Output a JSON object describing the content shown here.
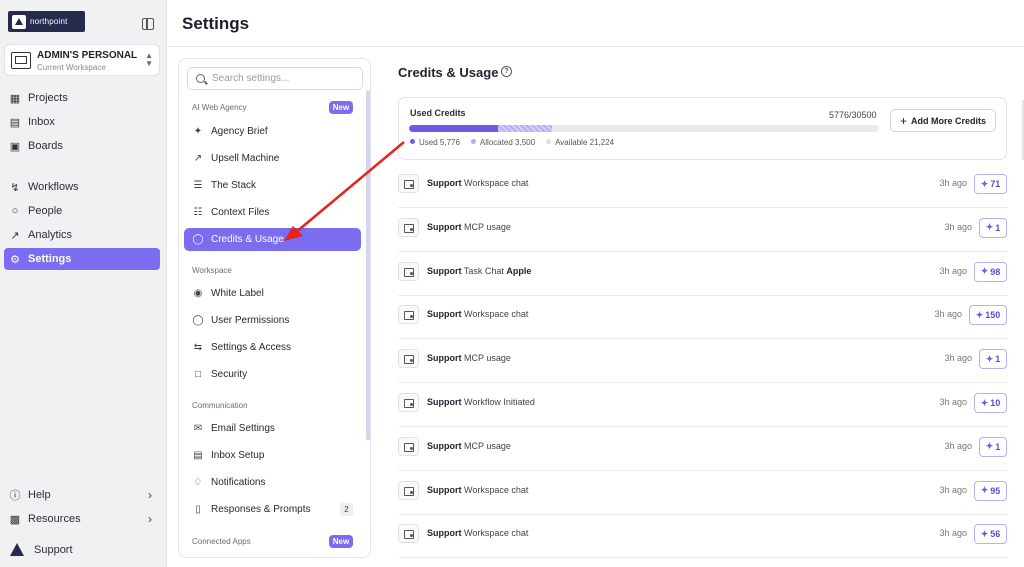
{
  "brand": {
    "name": "northpoint"
  },
  "workspace": {
    "name": "ADMIN'S PERSONAL ...",
    "subtitle": "Current Workspace"
  },
  "nav": {
    "items": [
      {
        "label": "Projects",
        "icon": "grid-icon"
      },
      {
        "label": "Inbox",
        "icon": "inbox-icon"
      },
      {
        "label": "Boards",
        "icon": "board-icon"
      },
      {
        "label": "Workflows",
        "icon": "workflow-icon"
      },
      {
        "label": "People",
        "icon": "person-icon"
      },
      {
        "label": "Analytics",
        "icon": "analytics-icon"
      },
      {
        "label": "Settings",
        "icon": "gear-icon"
      }
    ],
    "bottom": [
      {
        "label": "Help",
        "icon": "help-icon"
      },
      {
        "label": "Resources",
        "icon": "bar-chart-icon"
      }
    ],
    "support": "Support"
  },
  "page": {
    "title": "Settings"
  },
  "settings_panel": {
    "search_placeholder": "Search settings...",
    "sections": [
      {
        "label": "AI Web Agency",
        "badge": "New"
      },
      {
        "label": "Workspace"
      },
      {
        "label": "Communication"
      },
      {
        "label": "Connected Apps",
        "badge": "New"
      }
    ],
    "items": [
      {
        "label": "Agency Brief",
        "icon": "sparkle-icon"
      },
      {
        "label": "Upsell Machine",
        "icon": "trend-up-icon"
      },
      {
        "label": "The Stack",
        "icon": "layers-icon"
      },
      {
        "label": "Context Files",
        "icon": "file-icon"
      },
      {
        "label": "Credits & Usage",
        "icon": "coins-icon"
      },
      {
        "label": "White Label",
        "icon": "palette-icon"
      },
      {
        "label": "User Permissions",
        "icon": "shield-icon"
      },
      {
        "label": "Settings & Access",
        "icon": "sliders-icon"
      },
      {
        "label": "Security",
        "icon": "lock-icon"
      },
      {
        "label": "Email Settings",
        "icon": "mail-icon"
      },
      {
        "label": "Inbox Setup",
        "icon": "inbox-icon"
      },
      {
        "label": "Notifications",
        "icon": "bell-icon"
      },
      {
        "label": "Responses & Prompts",
        "icon": "bookmark-icon",
        "count": "2"
      }
    ]
  },
  "credits": {
    "title": "Credits & Usage",
    "card_label": "Used Credits",
    "count": "5776/30500",
    "used": 5776,
    "allocated": 3500,
    "total": 30500,
    "legend": {
      "used": "Used 5,776",
      "allocated": "Allocated 3,500",
      "available": "Available 21,224"
    },
    "colors": {
      "used": "#6c5be6",
      "allocated": "#b6adf5",
      "available": "#e8e8ee"
    },
    "add_button": "Add More Credits"
  },
  "usage_rows": [
    {
      "source": "Support",
      "desc": "Workspace chat",
      "extra": "",
      "time": "3h ago",
      "credits": "71"
    },
    {
      "source": "Support",
      "desc": "MCP usage",
      "extra": "",
      "time": "3h ago",
      "credits": "1"
    },
    {
      "source": "Support",
      "desc": "Task Chat",
      "extra": "Apple",
      "time": "3h ago",
      "credits": "98"
    },
    {
      "source": "Support",
      "desc": "Workspace chat",
      "extra": "",
      "time": "3h ago",
      "credits": "150"
    },
    {
      "source": "Support",
      "desc": "MCP usage",
      "extra": "",
      "time": "3h ago",
      "credits": "1"
    },
    {
      "source": "Support",
      "desc": "Workflow Initiated",
      "extra": "",
      "time": "3h ago",
      "credits": "10"
    },
    {
      "source": "Support",
      "desc": "MCP usage",
      "extra": "",
      "time": "3h ago",
      "credits": "1"
    },
    {
      "source": "Support",
      "desc": "Workspace chat",
      "extra": "",
      "time": "3h ago",
      "credits": "95"
    },
    {
      "source": "Support",
      "desc": "Workspace chat",
      "extra": "",
      "time": "3h ago",
      "credits": "56"
    }
  ],
  "annotation": {
    "arrow_color": "#e8211a"
  }
}
